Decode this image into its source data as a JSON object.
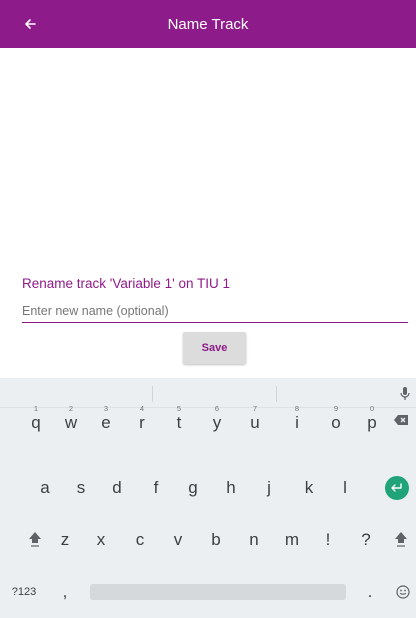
{
  "app_bar": {
    "title": "Name Track",
    "back_icon": "arrow-left-icon",
    "color": "#8e1b8a"
  },
  "form": {
    "rename_label": "Rename track 'Variable 1' on TIU 1",
    "name_input": {
      "placeholder": "Enter new name (optional)",
      "value": ""
    },
    "save_label": "Save"
  },
  "keyboard": {
    "row1": [
      {
        "char": "q",
        "hint": "1"
      },
      {
        "char": "w",
        "hint": "2"
      },
      {
        "char": "e",
        "hint": "3"
      },
      {
        "char": "r",
        "hint": "4"
      },
      {
        "char": "t",
        "hint": "5"
      },
      {
        "char": "y",
        "hint": "6"
      },
      {
        "char": "u",
        "hint": "7"
      },
      {
        "char": "i",
        "hint": "8"
      },
      {
        "char": "o",
        "hint": "9"
      },
      {
        "char": "p",
        "hint": "0"
      }
    ],
    "row2": [
      "a",
      "s",
      "d",
      "f",
      "g",
      "h",
      "j",
      "k",
      "l"
    ],
    "row3": [
      "z",
      "x",
      "c",
      "v",
      "b",
      "n",
      "m",
      "!",
      "?"
    ],
    "symbols_label": "?123",
    "comma": ",",
    "period": ".",
    "enter_color": "#21a37a"
  }
}
